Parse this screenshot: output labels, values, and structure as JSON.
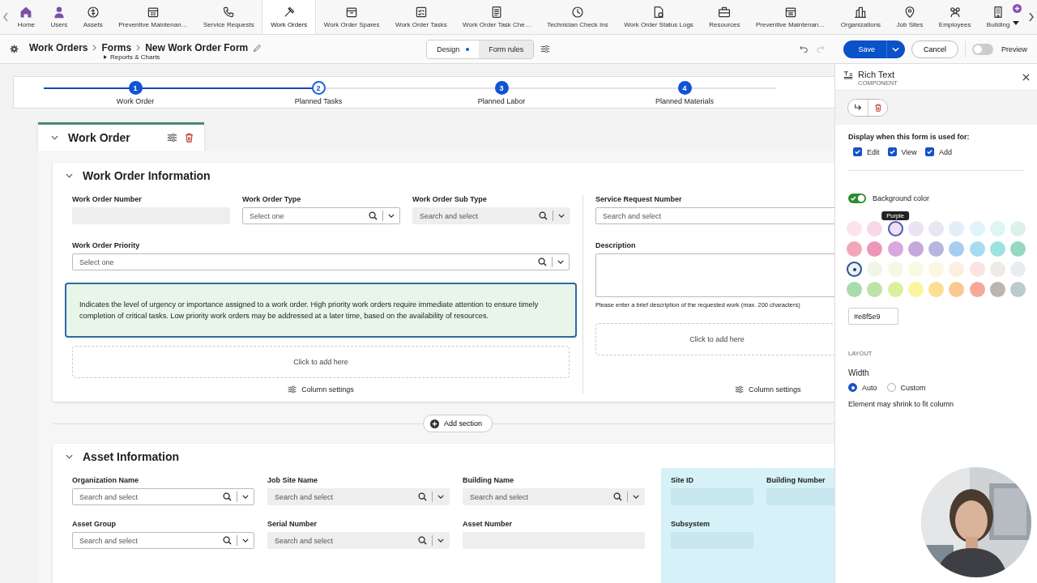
{
  "nav": {
    "items": [
      {
        "label": "Home",
        "selected": false
      },
      {
        "label": "Users",
        "selected": false
      },
      {
        "label": "Assets",
        "selected": false
      },
      {
        "label": "Preventive Maintenan…",
        "selected": false
      },
      {
        "label": "Service Requests",
        "selected": false
      },
      {
        "label": "Work Orders",
        "selected": true
      },
      {
        "label": "Work Order Spares",
        "selected": false
      },
      {
        "label": "Work Order Tasks",
        "selected": false
      },
      {
        "label": "Work Order Task Che…",
        "selected": false
      },
      {
        "label": "Technician Check Ins",
        "selected": false
      },
      {
        "label": "Work Order Status Logs",
        "selected": false
      },
      {
        "label": "Resources",
        "selected": false
      },
      {
        "label": "Preventive Maintenan…",
        "selected": false
      },
      {
        "label": "Organizations",
        "selected": false
      },
      {
        "label": "Job Sites",
        "selected": false
      },
      {
        "label": "Employees",
        "selected": false
      },
      {
        "label": "Building",
        "selected": false
      }
    ]
  },
  "toolbar": {
    "breadcrumb": [
      "Work Orders",
      "Forms",
      "New Work Order Form"
    ],
    "subtitle": "Reports & Charts",
    "modes": [
      {
        "label": "Design",
        "selected": true
      },
      {
        "label": "Form rules",
        "selected": false
      }
    ],
    "save": "Save",
    "cancel": "Cancel",
    "preview": {
      "label": "Preview",
      "on": false
    }
  },
  "steps": [
    {
      "number": "1",
      "label": "Work Order",
      "selected": false
    },
    {
      "number": "2",
      "label": "Planned Tasks",
      "selected": true
    },
    {
      "number": "3",
      "label": "Planned Labor",
      "selected": false
    },
    {
      "number": "4",
      "label": "Planned Materials",
      "selected": false
    }
  ],
  "group": {
    "title": "Work Order"
  },
  "info_section": {
    "title": "Work Order Information",
    "left_fields": [
      {
        "label": "Work Order Number",
        "kind": "input",
        "disabled": true
      },
      {
        "label": "Work Order Type",
        "kind": "select",
        "placeholder": "Select one",
        "disabled": false
      },
      {
        "label": "Work Order Sub Type",
        "kind": "select",
        "placeholder": "Search and select",
        "disabled": true
      }
    ],
    "priority": {
      "label": "Work Order Priority",
      "kind": "select",
      "placeholder": "Select one",
      "disabled": false
    },
    "rich_text": {
      "text": "Indicates the level of urgency or importance assigned to a work order. High priority work orders require immediate attention to ensure timely completion of critical tasks. Low priority work orders may be addressed at a later time, based on the availability of resources.",
      "color": "#e8f5e9",
      "selected": true
    },
    "add_here": "Click to add here",
    "column_settings": "Column settings",
    "right_fields": [
      {
        "label": "Service Request Number",
        "kind": "input",
        "placeholder": "Search and select",
        "disabled": false
      }
    ],
    "description": {
      "label": "Description",
      "hint": "Please enter a brief description of the requested work (max. 200 characters)"
    },
    "right_add_here": "Click to add here",
    "right_column_settings": "Column settings"
  },
  "add_section": "Add section",
  "asset_section": {
    "title": "Asset Information",
    "fields": [
      {
        "label": "Organization Name",
        "kind": "select",
        "placeholder": "Search and select",
        "disabled": false
      },
      {
        "label": "Job Site Name",
        "kind": "select",
        "placeholder": "Search and select",
        "disabled": true
      },
      {
        "label": "Building Name",
        "kind": "select",
        "placeholder": "Search and select",
        "disabled": true
      },
      {
        "label": "Asset Group",
        "kind": "select",
        "placeholder": "Search and select",
        "disabled": false
      },
      {
        "label": "Serial Number",
        "kind": "select",
        "placeholder": "Search and select",
        "disabled": true
      },
      {
        "label": "Asset Number",
        "kind": "input",
        "disabled": true
      }
    ],
    "linked_fields": [
      {
        "label": "Site ID",
        "kind": "input",
        "disabled": true
      },
      {
        "label": "Building Number",
        "kind": "input",
        "disabled": true
      },
      {
        "label": "Subsystem",
        "kind": "input",
        "disabled": true
      }
    ]
  },
  "panel": {
    "title": "Rich Text",
    "subtitle": "COMPONENT",
    "display_label": "Display when this form is used for:",
    "modes": [
      {
        "label": "Edit",
        "checked": true
      },
      {
        "label": "View",
        "checked": true
      },
      {
        "label": "Add",
        "checked": true
      }
    ],
    "background": {
      "label": "Background color",
      "on": true
    },
    "tooltip": "Purple",
    "swatches": [
      {
        "color": "#fce4ec",
        "selected": false,
        "hovered": false
      },
      {
        "color": "#f8d7e8",
        "selected": false,
        "hovered": false
      },
      {
        "color": "#efe0f5",
        "selected": false,
        "hovered": true
      },
      {
        "color": "#ebe2f3",
        "selected": false,
        "hovered": false
      },
      {
        "color": "#e6e6f4",
        "selected": false,
        "hovered": false
      },
      {
        "color": "#e1effa",
        "selected": false,
        "hovered": false
      },
      {
        "color": "#dff3fb",
        "selected": false,
        "hovered": false
      },
      {
        "color": "#def5f3",
        "selected": false,
        "hovered": false
      },
      {
        "color": "#dcf1eb",
        "selected": false,
        "hovered": false
      },
      {
        "color": "#f4a6b9",
        "selected": false,
        "hovered": false
      },
      {
        "color": "#ec97b9",
        "selected": false,
        "hovered": false
      },
      {
        "color": "#d8a8de",
        "selected": false,
        "hovered": false
      },
      {
        "color": "#c5a8dc",
        "selected": false,
        "hovered": false
      },
      {
        "color": "#b7b6e0",
        "selected": false,
        "hovered": false
      },
      {
        "color": "#a8cdf2",
        "selected": false,
        "hovered": false
      },
      {
        "color": "#a5dcf3",
        "selected": false,
        "hovered": false
      },
      {
        "color": "#9fe3e0",
        "selected": false,
        "hovered": false
      },
      {
        "color": "#96d8c3",
        "selected": false,
        "hovered": false
      },
      {
        "color": "#e8f5e9",
        "selected": true,
        "hovered": false
      },
      {
        "color": "#eff6e6",
        "selected": false,
        "hovered": false
      },
      {
        "color": "#f5f8e3",
        "selected": false,
        "hovered": false
      },
      {
        "color": "#f8f9e2",
        "selected": false,
        "hovered": false
      },
      {
        "color": "#fdf6e0",
        "selected": false,
        "hovered": false
      },
      {
        "color": "#fdefe0",
        "selected": false,
        "hovered": false
      },
      {
        "color": "#fbe3e3",
        "selected": false,
        "hovered": false
      },
      {
        "color": "#eeeae8",
        "selected": false,
        "hovered": false
      },
      {
        "color": "#e9edf0",
        "selected": false,
        "hovered": false
      },
      {
        "color": "#a8dcaa",
        "selected": false,
        "hovered": false
      },
      {
        "color": "#bde4a8",
        "selected": false,
        "hovered": false
      },
      {
        "color": "#dcef9e",
        "selected": false,
        "hovered": false
      },
      {
        "color": "#fbf69e",
        "selected": false,
        "hovered": false
      },
      {
        "color": "#fae08f",
        "selected": false,
        "hovered": false
      },
      {
        "color": "#fbc98f",
        "selected": false,
        "hovered": false
      },
      {
        "color": "#f7a898",
        "selected": false,
        "hovered": false
      },
      {
        "color": "#bcb4ae",
        "selected": false,
        "hovered": false
      },
      {
        "color": "#bccbcc",
        "selected": false,
        "hovered": false
      }
    ],
    "hex": "#e8f5e9",
    "layout_heading": "LAYOUT",
    "width_label": "Width",
    "width_options": [
      {
        "label": "Auto",
        "selected": true
      },
      {
        "label": "Custom",
        "selected": false
      }
    ],
    "hint": "Element may shrink to fit column"
  }
}
